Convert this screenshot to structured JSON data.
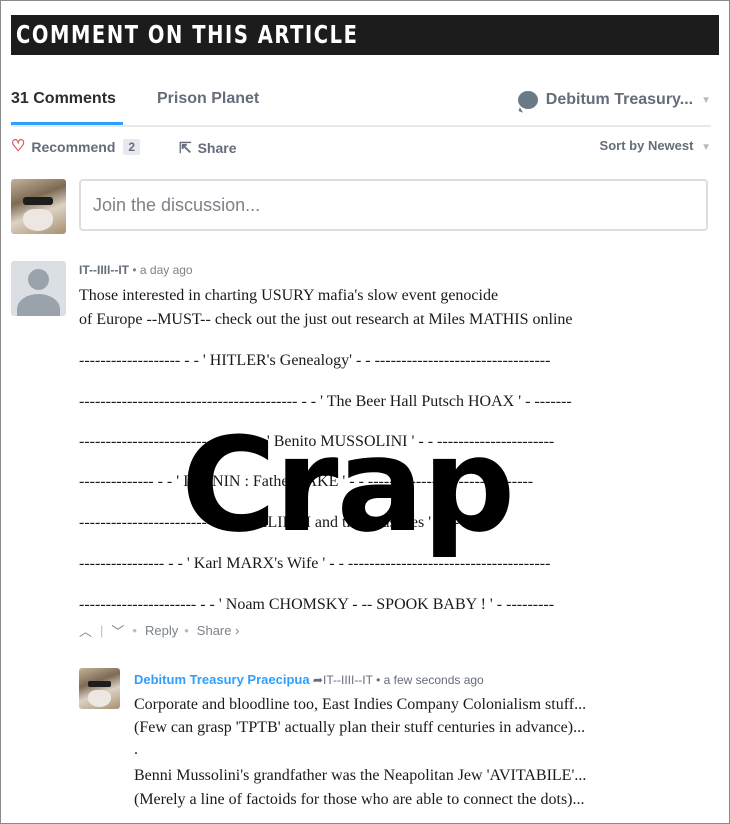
{
  "banner": {
    "title": "COMMENT ON THIS ARTICLE"
  },
  "tabs": {
    "comments": "31 Comments",
    "community": "Prison Planet"
  },
  "user": {
    "name": "Debitum Treasury..."
  },
  "toolbar": {
    "recommend": "Recommend",
    "recommend_count": "2",
    "share": "Share",
    "sort": "Sort by Newest"
  },
  "composer": {
    "placeholder": "Join the discussion..."
  },
  "comment": {
    "author": "IT--IIII--IT",
    "ago": "a day ago",
    "lines": [
      "Those interested in charting USURY mafia's slow event genocide",
      "of Europe --MUST-- check out the just out research at Miles MATHIS online",
      "------------------- - - ' HITLER's Genealogy' - - ---------------------------------",
      "----------------------------------------- - - ' The Beer Hall Putsch HOAX ' - -------",
      "------------------------------- - - ' Benito MUSSOLINI ' - - ----------------------",
      "-------------- - - ' I LENIN : Father FAKE ' - - -------------------------------",
      "------------------------- - - ' PHILIP III and the Crusades ' - - --------",
      "---------------- - - ' Karl MARX's Wife ' - - --------------------------------------",
      "---------------------- - - ' Noam CHOMSKY - -- SPOOK BABY ! ' - ---------"
    ],
    "reply": "Reply",
    "share": "Share ›"
  },
  "reply": {
    "author": "Debitum Treasury Praecipua",
    "to": "IT--IIII--IT",
    "ago": "a few seconds ago",
    "lines": [
      "Corporate and bloodline too, East Indies Company Colonialism stuff...",
      "(Few can grasp 'TPTB' actually plan their stuff centuries in advance)...",
      ".",
      "Benni Mussolini's grandfather was the Neapolitan Jew 'AVITABILE'...",
      "(Merely a line of factoids for those who are able to connect the dots)..."
    ]
  },
  "overlay": {
    "text": "Crap"
  }
}
